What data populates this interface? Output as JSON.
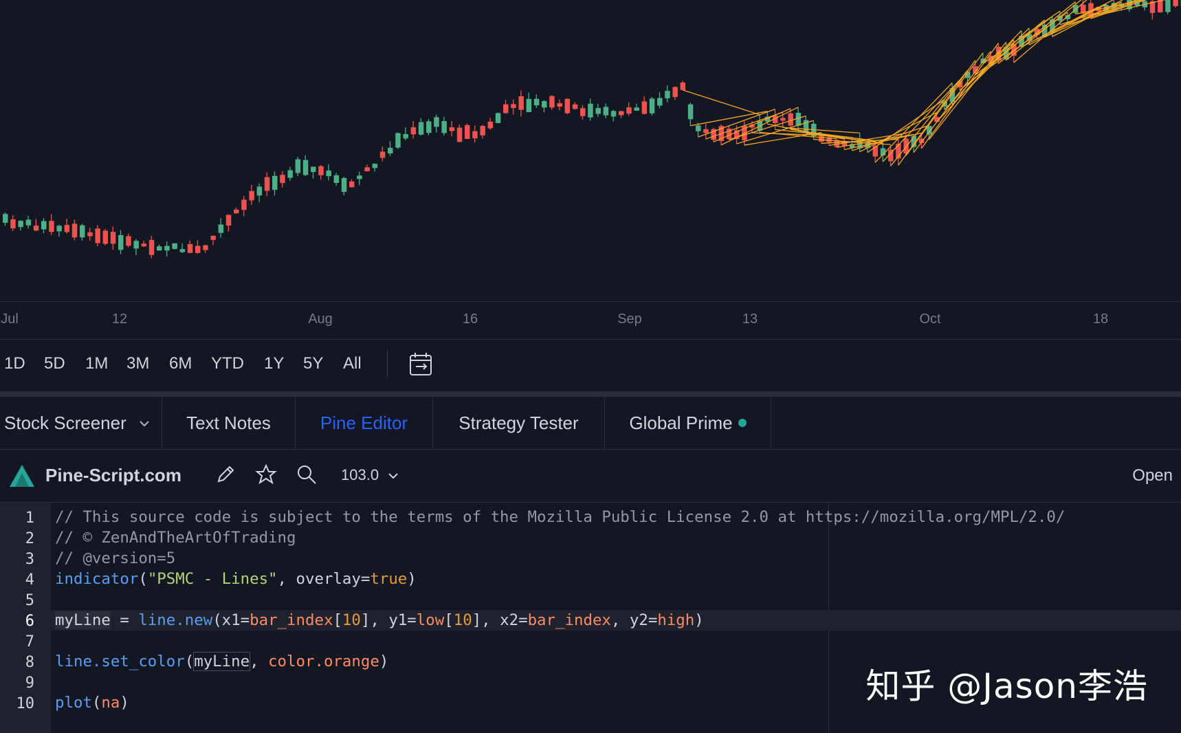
{
  "chart": {
    "up_color": "#4caf85",
    "down_color": "#ef5350",
    "line_color": "#f5a623",
    "background": "#131722",
    "time_axis": [
      "Jul",
      "12",
      "Aug",
      "16",
      "Sep",
      "13",
      "Oct",
      "18"
    ]
  },
  "range_buttons": [
    "1D",
    "5D",
    "1M",
    "3M",
    "6M",
    "YTD",
    "1Y",
    "5Y",
    "All"
  ],
  "tabs": {
    "stock_screener": "Stock Screener",
    "text_notes": "Text Notes",
    "pine_editor": "Pine Editor",
    "strategy_tester": "Strategy Tester",
    "global_prime": "Global Prime",
    "active": "Pine Editor",
    "status_color": "#26a69a"
  },
  "toolbar": {
    "script_name": "Pine-Script.com",
    "version": "103.0",
    "open_label": "Open",
    "icons": [
      "pencil-icon",
      "star-icon",
      "search-icon",
      "chevron-down-icon"
    ]
  },
  "code": {
    "line_numbers": [
      "1",
      "2",
      "3",
      "4",
      "5",
      "6",
      "7",
      "8",
      "9",
      "10"
    ],
    "active_line": 6,
    "lines": {
      "l1": "// This source code is subject to the terms of the Mozilla Public License 2.0 at https://mozilla.org/MPL/2.0/",
      "l2": "// © ZenAndTheArtOfTrading",
      "l3": "// @version=5",
      "l4": {
        "fn": "indicator",
        "p1": "(",
        "str": "\"PSMC - Lines\"",
        "p2": ", overlay=",
        "kw": "true",
        "p3": ")"
      },
      "l6": {
        "var": "myLine",
        "eq": " = ",
        "fn": "line.new",
        "a1": "(x1=",
        "b1": "bar_index",
        "a2": "[",
        "n1": "10",
        "a3": "], y1=",
        "b2": "low",
        "a4": "[",
        "n2": "10",
        "a5": "], x2=",
        "b3": "bar_index",
        "a6": ", y2=",
        "b4": "high",
        "a7": ")"
      },
      "l8": {
        "fn": "line.set_color",
        "a1": "(",
        "var": "myLine",
        "a2": ", ",
        "col": "color.orange",
        "a3": ")"
      },
      "l10": {
        "fn": "plot",
        "a1": "(",
        "na": "na",
        "a2": ")"
      }
    }
  },
  "watermark": "知乎 @Jason李浩"
}
